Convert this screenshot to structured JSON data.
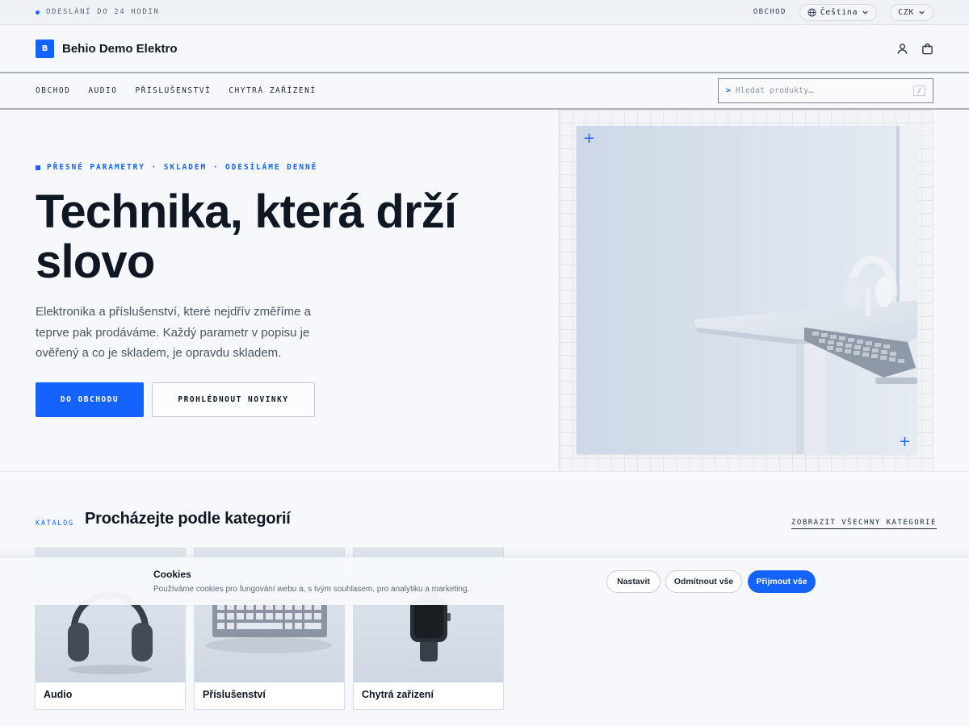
{
  "topbar": {
    "shipping_text": "ODESLÁNÍ DO 24 HODIN",
    "shop_link": "OBCHOD",
    "language": "Čeština",
    "currency": "CZK"
  },
  "header": {
    "logo_letter": "B",
    "brand_name": "Behio Demo Elektro",
    "icons": [
      "user-icon",
      "cart-icon"
    ]
  },
  "nav": {
    "links": [
      "OBCHOD",
      "AUDIO",
      "PŘÍSLUŠENSTVÍ",
      "CHYTRÁ ZAŘÍZENÍ"
    ],
    "search": {
      "prompt": ">",
      "placeholder": "Hledat produkty…",
      "shortcut": "/"
    }
  },
  "hero": {
    "eyebrow": "PŘESNÉ PARAMETRY · SKLADEM · ODESÍLÁME DENNĚ",
    "title": "Technika, která drží slovo",
    "description": "Elektronika a příslušenství, které nejdřív změříme a teprve pak prodáváme. Každý parametr v popisu je ověřený a co je skladem, je opravdu skladem.",
    "primary_button": "DO OBCHODU",
    "secondary_button": "PROHLÉDNOUT NOVINKY"
  },
  "catalog": {
    "tag": "KATALOG",
    "title": "Procházejte podle kategorií",
    "view_all": "ZOBRAZIT VŠECHNY KATEGORIE",
    "cards": [
      {
        "label": "Audio"
      },
      {
        "label": "Příslušenství"
      },
      {
        "label": "Chytrá zařízení"
      }
    ]
  },
  "cookie": {
    "title": "Cookies",
    "text": "Používáme cookies pro fungování webu a, s tvým souhlasem, pro analytiku a marketing.",
    "settings_button": "Nastavit",
    "reject_button": "Odmítnout vše",
    "accept_button": "Přijmout vše"
  },
  "colors": {
    "accent": "#1463ff",
    "text": "#0f1722",
    "background": "#f6f8fb"
  }
}
